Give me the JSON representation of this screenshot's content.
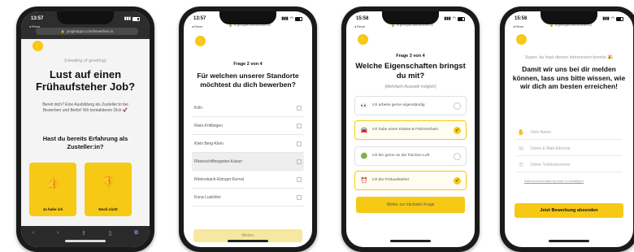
{
  "screens": [
    {
      "time": "13:57",
      "back_link": "◂ Rewe",
      "url": "jungleapps.com/bewerben.io",
      "greeting": "(Heading of greeting)",
      "headline": "Lust auf einen Frühaufsteher Job?",
      "intro": "Bereit dich? Eine Ausbildung als Zusteller:in bei Bewerben und Berlin! Wir kontaktieren Dich 🚀",
      "question": "Hast du bereits Erfahrung als Zusteller:in?",
      "answers": [
        {
          "icon": "thumbs-up-icon",
          "label": "Ja habe ich"
        },
        {
          "icon": "thumbs-down-icon",
          "label": "Noch nicht"
        }
      ]
    },
    {
      "time": "13:57",
      "back_link": "◂ Rewe",
      "url": "a.perspectivefunnel.co",
      "page": "Frage 2 von 4",
      "headline": "Für welchen unserer Standorte möchtest du dich bewerben?",
      "locations": [
        {
          "label": "Köln",
          "selected": false
        },
        {
          "label": "Klein-Frittlingen",
          "selected": false
        },
        {
          "label": "Klein Berg-Klein",
          "selected": false
        },
        {
          "label": "Rheinschiffergarten-Kaiser",
          "selected": true
        },
        {
          "label": "Rheinsbach-Ehinger-Kernsl",
          "selected": false
        },
        {
          "label": "Kuna Luskölns",
          "selected": false
        }
      ],
      "next_button": "Weiter"
    },
    {
      "time": "15:58",
      "back_link": "◂ Rewe",
      "url": "a.perspectivefunnel.co",
      "page": "Frage 3 von 4",
      "headline": "Welche Eigenschaften bringst du mit?",
      "subtitle": "(Mehrfach-Auswahl möglich)",
      "properties": [
        {
          "emoji": "👀",
          "text": "Ich arbeite gerne eigenständig",
          "selected": false
        },
        {
          "emoji": "🚘",
          "text": "Ich habe einen Klasse B Führerschein",
          "selected": true
        },
        {
          "emoji": "🟢",
          "text": "Ich bin gerne an der frischen Luft",
          "selected": false
        },
        {
          "emoji": "⏰",
          "text": "Ich bin Frühaufsteher",
          "selected": true
        }
      ],
      "next_button": "Weiter zur nächsten Frage"
    },
    {
      "time": "15:58",
      "back_link": "◂ Rewe",
      "url": "a.perspectivefunnel.co",
      "greeting": "Super, du hast diesen Interessent bereits 🎉",
      "headline": "Damit wir uns bei dir melden können, lass uns bitte wissen, wie wir dich am besten erreichen!",
      "fields": [
        {
          "icon": "hand-wave-icon",
          "placeholder": "Dein Name"
        },
        {
          "icon": "mail-icon",
          "placeholder": "Deine E-Mail-Adresse"
        },
        {
          "icon": "phone-icon",
          "placeholder": "Deine Telefonnummer"
        }
      ],
      "consent": "Datenschutzerklärung lesen & bestätigen",
      "submit_button": "Jetzt Bewerbung absenden"
    }
  ]
}
